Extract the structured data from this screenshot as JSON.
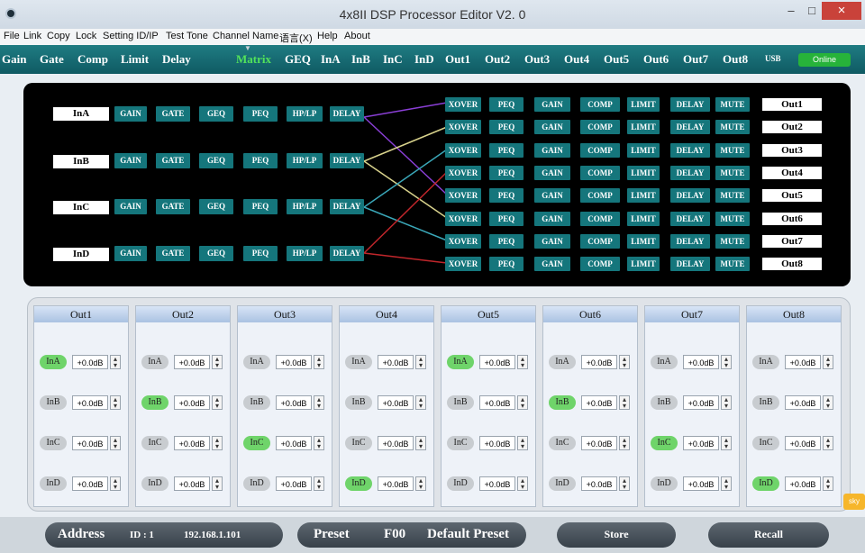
{
  "window": {
    "title": "4x8II DSP Processor Editor V2. 0",
    "minimize": "–",
    "maximize": "□",
    "close": "×"
  },
  "menu": [
    "File",
    "Link",
    "Copy",
    "Lock",
    "Setting ID/IP",
    "Test Tone",
    "Channel Name",
    "语言(X)",
    "Help",
    "About"
  ],
  "tabs": [
    "Gain",
    "Gate",
    "Comp",
    "Limit",
    "Delay",
    "Matrix",
    "GEQ",
    "InA",
    "InB",
    "InC",
    "InD",
    "Out1",
    "Out2",
    "Out3",
    "Out4",
    "Out5",
    "Out6",
    "Out7",
    "Out8"
  ],
  "active_tab": "Matrix",
  "usb_label": "USB",
  "online_label": "Online",
  "inputs": [
    {
      "name": "InA",
      "blocks": [
        "GAIN",
        "GATE",
        "GEQ",
        "PEQ",
        "HP/LP",
        "DELAY"
      ]
    },
    {
      "name": "InB",
      "blocks": [
        "GAIN",
        "GATE",
        "GEQ",
        "PEQ",
        "HP/LP",
        "DELAY"
      ]
    },
    {
      "name": "InC",
      "blocks": [
        "GAIN",
        "GATE",
        "GEQ",
        "PEQ",
        "HP/LP",
        "DELAY"
      ]
    },
    {
      "name": "InD",
      "blocks": [
        "GAIN",
        "GATE",
        "GEQ",
        "PEQ",
        "HP/LP",
        "DELAY"
      ]
    }
  ],
  "output_blocks": [
    "XOVER",
    "PEQ",
    "GAIN",
    "COMP",
    "LIMIT",
    "DELAY",
    "MUTE"
  ],
  "outputs": [
    "Out1",
    "Out2",
    "Out3",
    "Out4",
    "Out5",
    "Out6",
    "Out7",
    "Out8"
  ],
  "routing": [
    {
      "input": "InA",
      "outputs": [
        "Out1",
        "Out5"
      ],
      "color": "#8a3fd6"
    },
    {
      "input": "InB",
      "outputs": [
        "Out2",
        "Out6"
      ],
      "color": "#d8d28c"
    },
    {
      "input": "InC",
      "outputs": [
        "Out3",
        "Out7"
      ],
      "color": "#3aa7b8"
    },
    {
      "input": "InD",
      "outputs": [
        "Out4",
        "Out8"
      ],
      "color": "#c0262b"
    }
  ],
  "mixer": {
    "columns": [
      {
        "title": "Out1",
        "rows": [
          {
            "in": "InA",
            "gain": "+0.0dB",
            "on": true
          },
          {
            "in": "InB",
            "gain": "+0.0dB",
            "on": false
          },
          {
            "in": "InC",
            "gain": "+0.0dB",
            "on": false
          },
          {
            "in": "InD",
            "gain": "+0.0dB",
            "on": false
          }
        ]
      },
      {
        "title": "Out2",
        "rows": [
          {
            "in": "InA",
            "gain": "+0.0dB",
            "on": false
          },
          {
            "in": "InB",
            "gain": "+0.0dB",
            "on": true
          },
          {
            "in": "InC",
            "gain": "+0.0dB",
            "on": false
          },
          {
            "in": "InD",
            "gain": "+0.0dB",
            "on": false
          }
        ]
      },
      {
        "title": "Out3",
        "rows": [
          {
            "in": "InA",
            "gain": "+0.0dB",
            "on": false
          },
          {
            "in": "InB",
            "gain": "+0.0dB",
            "on": false
          },
          {
            "in": "InC",
            "gain": "+0.0dB",
            "on": true
          },
          {
            "in": "InD",
            "gain": "+0.0dB",
            "on": false
          }
        ]
      },
      {
        "title": "Out4",
        "rows": [
          {
            "in": "InA",
            "gain": "+0.0dB",
            "on": false
          },
          {
            "in": "InB",
            "gain": "+0.0dB",
            "on": false
          },
          {
            "in": "InC",
            "gain": "+0.0dB",
            "on": false
          },
          {
            "in": "InD",
            "gain": "+0.0dB",
            "on": true
          }
        ]
      },
      {
        "title": "Out5",
        "rows": [
          {
            "in": "InA",
            "gain": "+0.0dB",
            "on": true
          },
          {
            "in": "InB",
            "gain": "+0.0dB",
            "on": false
          },
          {
            "in": "InC",
            "gain": "+0.0dB",
            "on": false
          },
          {
            "in": "InD",
            "gain": "+0.0dB",
            "on": false
          }
        ]
      },
      {
        "title": "Out6",
        "rows": [
          {
            "in": "InA",
            "gain": "+0.0dB",
            "on": false
          },
          {
            "in": "InB",
            "gain": "+0.0dB",
            "on": true
          },
          {
            "in": "InC",
            "gain": "+0.0dB",
            "on": false
          },
          {
            "in": "InD",
            "gain": "+0.0dB",
            "on": false
          }
        ]
      },
      {
        "title": "Out7",
        "rows": [
          {
            "in": "InA",
            "gain": "+0.0dB",
            "on": false
          },
          {
            "in": "InB",
            "gain": "+0.0dB",
            "on": false
          },
          {
            "in": "InC",
            "gain": "+0.0dB",
            "on": true
          },
          {
            "in": "InD",
            "gain": "+0.0dB",
            "on": false
          }
        ]
      },
      {
        "title": "Out8",
        "rows": [
          {
            "in": "InA",
            "gain": "+0.0dB",
            "on": false
          },
          {
            "in": "InB",
            "gain": "+0.0dB",
            "on": false
          },
          {
            "in": "InC",
            "gain": "+0.0dB",
            "on": false
          },
          {
            "in": "InD",
            "gain": "+0.0dB",
            "on": true
          }
        ]
      }
    ]
  },
  "statusbar": {
    "address_label": "Address",
    "id": "ID : 1",
    "ip": "192.168.1.101",
    "preset_label": "Preset",
    "preset_code": "F00",
    "preset_name": "Default Preset",
    "store": "Store",
    "recall": "Recall"
  },
  "side_widgets": {
    "badge": "sky"
  },
  "colors": {
    "tab_bg": "#12666d",
    "active_tab": "#52e35a",
    "block": "#15767c",
    "online": "#27b33a",
    "enabled_input": "#6fd46a"
  }
}
